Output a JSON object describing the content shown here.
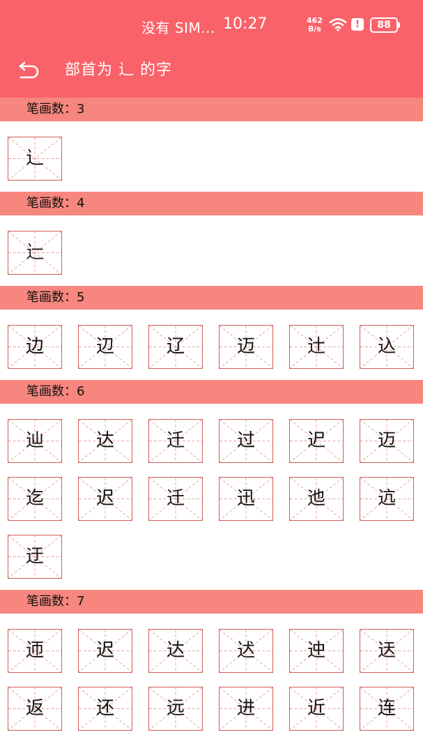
{
  "status_bar": {
    "carrier": "没有 SIM...",
    "time": "10:27",
    "net_speed_value": "462",
    "net_speed_unit": "B/s",
    "battery": "88"
  },
  "header": {
    "title": "部首为 辶 的字"
  },
  "sections": [
    {
      "label": "笔画数：3",
      "chars": [
        "辶"
      ]
    },
    {
      "label": "笔画数：4",
      "chars": [
        "辷"
      ]
    },
    {
      "label": "笔画数：5",
      "chars": [
        "边",
        "辺",
        "辽",
        "迈",
        "辻",
        "込"
      ]
    },
    {
      "label": "笔画数：6",
      "chars": [
        "辿",
        "达",
        "迁",
        "过",
        "迉",
        "迈",
        "迄",
        "迟",
        "迁",
        "迅",
        "迆",
        "迒",
        "迂"
      ]
    },
    {
      "label": "笔画数：7",
      "chars": [
        "迊",
        "迟",
        "达",
        "迖",
        "迚",
        "迗",
        "返",
        "还",
        "远",
        "进",
        "近",
        "连"
      ]
    }
  ],
  "colors": {
    "header_bg": "#fa626a",
    "section_bg": "#f7867e",
    "cell_border": "#cf5d57",
    "guide_line": "#e9a29d"
  }
}
